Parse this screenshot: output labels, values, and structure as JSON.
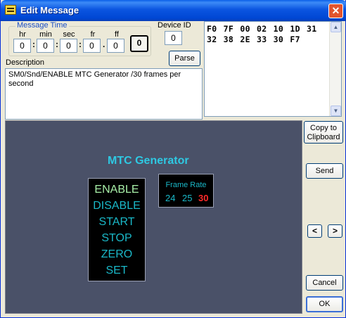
{
  "window": {
    "title": "Edit Message",
    "close": "✕"
  },
  "message_time": {
    "legend": "Message Time",
    "labels": {
      "hr": "hr",
      "min": "min",
      "sec": "sec",
      "fr": "fr",
      "ff": "ff"
    },
    "values": {
      "hr": "0",
      "min": "0",
      "sec": "0",
      "fr": "0",
      "ff": "0"
    },
    "separators": {
      "s1": ":",
      "s2": ":",
      "s3": ":",
      "s4": "."
    },
    "zero_button": "0"
  },
  "device": {
    "label": "Device ID",
    "value": "0"
  },
  "parse_button": "Parse",
  "description": {
    "label": "Description",
    "text": "SM0/Snd/ENABLE MTC Generator /30 frames per second"
  },
  "hex": {
    "text": "F0 7F 00 02 10 1D 31 32 38 2E 33 30 F7"
  },
  "panel": {
    "title": "MTC Generator",
    "menu": [
      "ENABLE",
      "DISABLE",
      "START",
      "STOP",
      "ZERO",
      "SET"
    ],
    "active_item": "ENABLE",
    "frame_rate": {
      "label": "Frame Rate",
      "options": [
        "24",
        "25",
        "30"
      ],
      "selected": "30"
    }
  },
  "buttons": {
    "copy_line1": "Copy to",
    "copy_line2": "Clipboard",
    "send": "Send",
    "prev": "<",
    "next": ">",
    "cancel": "Cancel",
    "ok": "OK"
  },
  "colors": {
    "titlebar": "#0054e3",
    "panel_bg": "#4a5168",
    "accent_cyan": "#2ec9e3",
    "active_green": "#a8f0a8",
    "selected_red": "#ff2a2a"
  }
}
